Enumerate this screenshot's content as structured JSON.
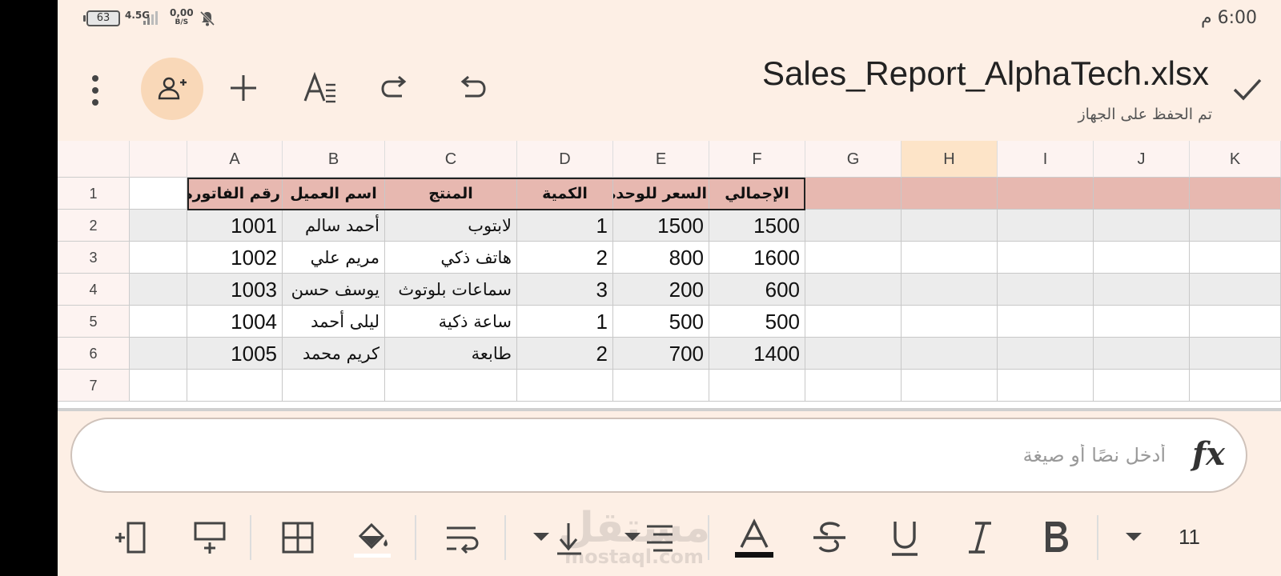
{
  "status_bar": {
    "battery": "63",
    "network": "4.5G",
    "speed_value": "0,00",
    "speed_unit": "B/S",
    "time": "6:00 م"
  },
  "doc": {
    "title": "Sales_Report_AlphaTech.xlsx",
    "save_status": "تم الحفظ على الجهاز"
  },
  "grid": {
    "columns": [
      "A",
      "B",
      "C",
      "D",
      "E",
      "F",
      "G",
      "H",
      "I",
      "J",
      "K"
    ],
    "selected_column": "H",
    "row_numbers": [
      "1",
      "2",
      "3",
      "4",
      "5",
      "6",
      "7"
    ],
    "headers": [
      "رقم الفاتورة",
      "اسم العميل",
      "المنتج",
      "الكمية",
      "السعر للوحدة",
      "الإجمالي"
    ],
    "rows": [
      [
        "1001",
        "أحمد سالم",
        "لابتوب",
        "1",
        "1500",
        "1500"
      ],
      [
        "1002",
        "مريم علي",
        "هاتف ذكي",
        "2",
        "800",
        "1600"
      ],
      [
        "1003",
        "يوسف حسن",
        "سماعات بلوتوث",
        "3",
        "200",
        "600"
      ],
      [
        "1004",
        "ليلى أحمد",
        "ساعة ذكية",
        "1",
        "500",
        "500"
      ],
      [
        "1005",
        "كريم محمد",
        "طابعة",
        "2",
        "700",
        "1400"
      ]
    ]
  },
  "formula_bar": {
    "value": "",
    "placeholder": "أدخل نصًا أو صيغة",
    "fx_label": "fx"
  },
  "toolbar": {
    "font_size": "11",
    "watermark_ar": "مستقل",
    "watermark_en": "mostaql.com"
  },
  "colors": {
    "background": "#fdefe5",
    "header_fill": "#e7b8b0",
    "accent": "#f9d8b8"
  }
}
